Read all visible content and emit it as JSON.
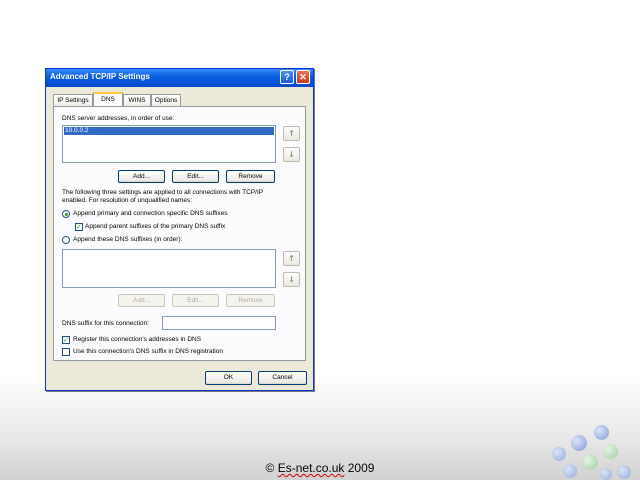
{
  "dialog": {
    "title": "Advanced TCP/IP Settings",
    "help_glyph": "?",
    "close_glyph": "✕"
  },
  "tabs": [
    {
      "label": "IP Settings",
      "active": false
    },
    {
      "label": "DNS",
      "active": true
    },
    {
      "label": "WINS",
      "active": false
    },
    {
      "label": "Options",
      "active": false
    }
  ],
  "dns": {
    "servers_label": "DNS server addresses, in order of use:",
    "servers": [
      "10.0.0.2"
    ],
    "add_label": "Add...",
    "edit_label": "Edit...",
    "remove_label": "Remove",
    "up_glyph": "↑",
    "down_glyph": "↓",
    "info_line1": "The following three settings are applied to all connections with TCP/IP",
    "info_line2": "enabled. For resolution of unqualified names:",
    "radio_primary_label": "Append primary and connection specific DNS suffixes",
    "check_parent_label": "Append parent suffixes of the primary DNS suffix",
    "radio_these_label": "Append these DNS suffixes (in order):",
    "suffix_add_label": "Add...",
    "suffix_edit_label": "Edit...",
    "suffix_remove_label": "Remove",
    "suffix_connection_label": "DNS suffix for this connection:",
    "suffix_connection_value": "",
    "register_label": "Register this connection's addresses in DNS",
    "use_suffix_label": "Use this connection's DNS suffix in DNS registration",
    "radio_primary_selected": true,
    "check_parent_checked": true,
    "register_checked": true,
    "use_suffix_checked": false
  },
  "buttons": {
    "ok_label": "OK",
    "cancel_label": "Cancel"
  },
  "footer": {
    "prefix": "© ",
    "underlined": "Es-net.co.uk",
    "suffix": " 2009"
  },
  "colors": {
    "titlebar": "#0a5fe0",
    "selection": "#316ac5",
    "decor_blue": "#8fa8dc",
    "decor_green": "#9fcf9f"
  }
}
